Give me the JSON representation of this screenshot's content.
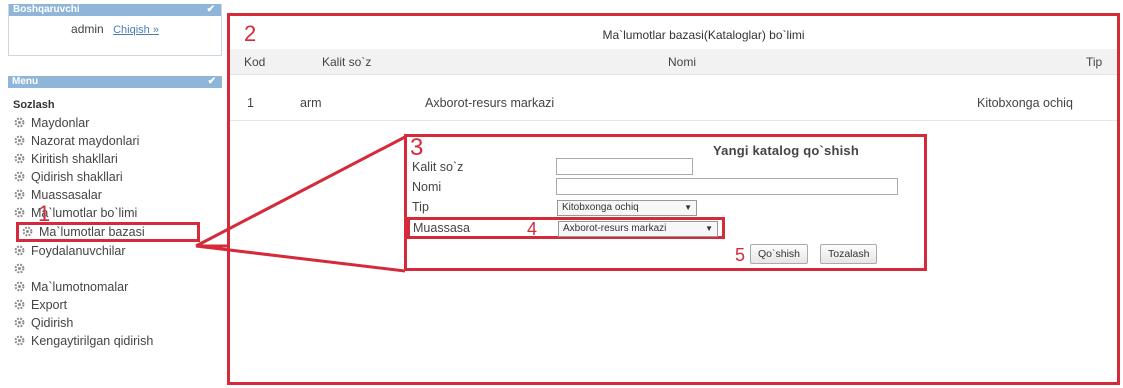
{
  "user_panel": {
    "title": "Boshqaruvchi",
    "username": "admin",
    "logout_label": "Chiqish »"
  },
  "menu": {
    "title": "Menu",
    "section": "Sozlash",
    "items": [
      {
        "label": "Maydonlar"
      },
      {
        "label": "Nazorat maydonlari"
      },
      {
        "label": "Kiritish shakllari"
      },
      {
        "label": "Qidirish shakllari"
      },
      {
        "label": "Muassasalar"
      },
      {
        "label": "Ma`lumotlar bo`limi"
      },
      {
        "label": "Ma`lumotlar bazasi"
      },
      {
        "label": "Foydalanuvchilar"
      },
      {
        "label": ""
      },
      {
        "label": "Ma`lumotnomalar"
      },
      {
        "label": "Export"
      },
      {
        "label": "Qidirish"
      },
      {
        "label": "Kengaytirilgan qidirish"
      }
    ]
  },
  "annotations": {
    "n1": "1",
    "n2": "2",
    "n3": "3",
    "n4": "4",
    "n5": "5"
  },
  "catalog": {
    "title": "Ma`lumotlar bazasi(Kataloglar) bo`limi",
    "columns": {
      "kod": "Kod",
      "keyword": "Kalit so`z",
      "name": "Nomi",
      "type": "Tip"
    },
    "rows": [
      {
        "kod": "1",
        "keyword": "arm",
        "name": "Axborot-resurs markazi",
        "type": "Kitobxonga ochiq"
      }
    ]
  },
  "add_form": {
    "title": "Yangi katalog qo`shish",
    "keyword_label": "Kalit so`z",
    "name_label": "Nomi",
    "type_label": "Tip",
    "type_value": "Kitobxonga ochiq",
    "institution_label": "Muassasa",
    "institution_value": "Axborot-resurs markazi",
    "add_button": "Qo`shish",
    "clear_button": "Tozalash"
  },
  "colors": {
    "highlight": "#d42a3a",
    "panel_header": "#8fb6d9"
  }
}
